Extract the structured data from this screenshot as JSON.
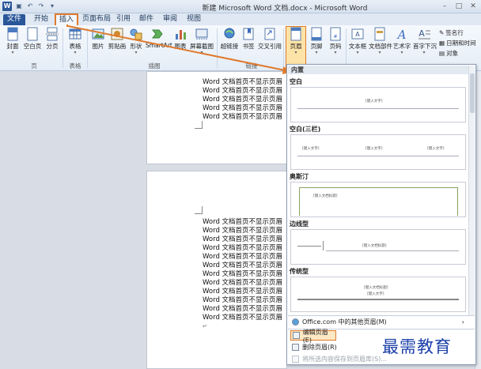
{
  "window": {
    "title": "新建 Microsoft Word 文档.docx - Microsoft Word",
    "logo": "W"
  },
  "tabs": [
    "文件",
    "开始",
    "插入",
    "页面布局",
    "引用",
    "邮件",
    "审阅",
    "视图"
  ],
  "ribbon": {
    "buttons": [
      {
        "label": "封面",
        "icon": "cover-icon"
      },
      {
        "label": "空白页",
        "icon": "blank-page-icon"
      },
      {
        "label": "分页",
        "icon": "page-break-icon"
      },
      {
        "label": "表格",
        "icon": "table-icon"
      },
      {
        "label": "图片",
        "icon": "picture-icon"
      },
      {
        "label": "剪贴画",
        "icon": "clipart-icon"
      },
      {
        "label": "形状",
        "icon": "shapes-icon"
      },
      {
        "label": "SmartArt",
        "icon": "smartart-icon"
      },
      {
        "label": "图表",
        "icon": "chart-icon"
      },
      {
        "label": "屏幕截图",
        "icon": "screenshot-icon"
      },
      {
        "label": "超链接",
        "icon": "hyperlink-icon"
      },
      {
        "label": "书签",
        "icon": "bookmark-icon"
      },
      {
        "label": "交叉引用",
        "icon": "crossref-icon"
      },
      {
        "label": "页眉",
        "icon": "header-icon"
      },
      {
        "label": "页脚",
        "icon": "footer-icon"
      },
      {
        "label": "页码",
        "icon": "page-number-icon"
      },
      {
        "label": "文本框",
        "icon": "textbox-icon"
      },
      {
        "label": "文档部件",
        "icon": "quickparts-icon"
      },
      {
        "label": "艺术字",
        "icon": "wordart-icon"
      },
      {
        "label": "首字下沉",
        "icon": "dropcap-icon"
      }
    ],
    "small_buttons": [
      "签名行",
      "日期和时间",
      "对象"
    ],
    "groups": [
      "页",
      "表格",
      "插图",
      "链接"
    ]
  },
  "document": {
    "line_text": "Word 文档首页不显示页眉"
  },
  "dropdown": {
    "header": "内置",
    "sections": [
      "空白",
      "空白(三栏)",
      "奥斯汀",
      "边线型",
      "传统型"
    ],
    "placeholder": "[键入文字]",
    "placeholder_title": "[键入文档标题]",
    "menu": [
      "Office.com 中的其他页眉(M)",
      "编辑页眉(E)",
      "删除页眉(R)",
      "将所选内容保存到页眉库(S)..."
    ]
  },
  "watermark": "最需教育",
  "colors": {
    "accent": "#e07a2c",
    "file_tab": "#2a5699",
    "watermark": "#1b3fa8"
  }
}
